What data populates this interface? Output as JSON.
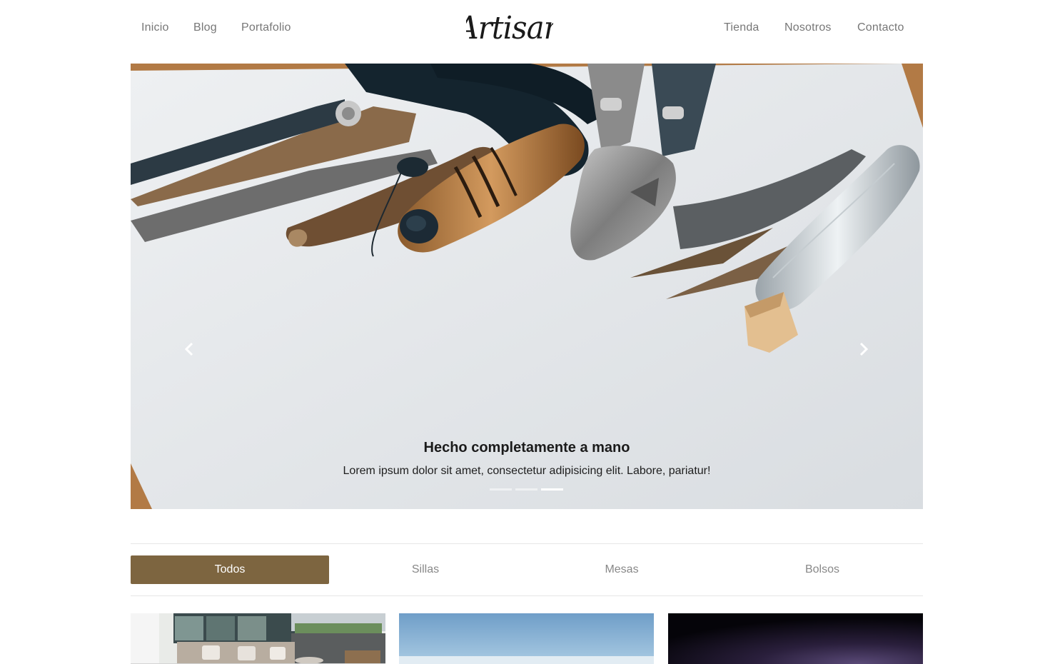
{
  "nav": {
    "left": [
      {
        "label": "Inicio"
      },
      {
        "label": "Blog"
      },
      {
        "label": "Portafolio"
      }
    ],
    "logo": "Artisan",
    "right": [
      {
        "label": "Tienda"
      },
      {
        "label": "Nosotros"
      },
      {
        "label": "Contacto"
      }
    ]
  },
  "hero": {
    "title": "Hecho completamente a mano",
    "text": "Lorem ipsum dolor sit amet, consectetur adipisicing elit. Labore, pariatur!",
    "prev_icon": "chevron-left-icon",
    "next_icon": "chevron-right-icon",
    "slide_count": 3,
    "active_slide": 3
  },
  "filter": {
    "items": [
      {
        "label": "Todos",
        "active": true
      },
      {
        "label": "Sillas",
        "active": false
      },
      {
        "label": "Mesas",
        "active": false
      },
      {
        "label": "Bolsos",
        "active": false
      }
    ]
  },
  "colors": {
    "accent": "#7d6540",
    "nav_text": "#777777",
    "divider": "#e6e6e6"
  }
}
